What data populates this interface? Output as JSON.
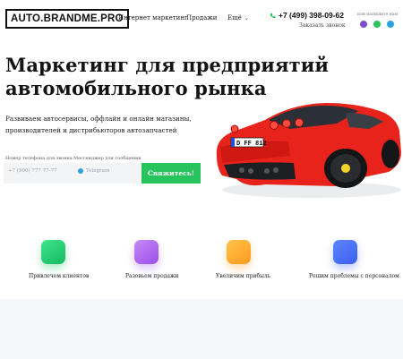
{
  "header": {
    "logo": "AUTO.BRANDME.PRO",
    "nav": [
      {
        "label": "Интернет маркетинг"
      },
      {
        "label": "Продажи"
      },
      {
        "label": "Ещё"
      }
    ],
    "phone": "+7 (499) 398-09-62",
    "callback": "Заказать звонок",
    "messengers_label": "или напишите нам",
    "messengers": [
      "viber-icon",
      "whatsapp-icon",
      "telegram-icon"
    ]
  },
  "hero": {
    "title": "Маркетинг для предприятий автомобильного рынка",
    "subtitle": "Развиваем автосервисы, оффлайн и онлайн магазины, производителей и дистрибьюторов автозапчастей",
    "car_plate": "D FF 812"
  },
  "form": {
    "phone_label": "Номер телефона для звонка",
    "phone_placeholder": "+7 (900) 777 77-77",
    "messenger_label": "Мессенджер для сообщения",
    "messenger_value": "Telegram",
    "submit": "Свяжитесь!"
  },
  "features": [
    {
      "label": "Привлечем клиентов",
      "icon": "users-icon",
      "color": "#27c35d"
    },
    {
      "label": "Разовьем продажи",
      "icon": "sales-icon",
      "color": "#a85ff0"
    },
    {
      "label": "Увеличим прибыль",
      "icon": "profit-icon",
      "color": "#ffab2e"
    },
    {
      "label": "Решим проблемы с персоналом",
      "icon": "staff-icon",
      "color": "#4a6ef5"
    }
  ],
  "colors": {
    "accent_green": "#27c35d",
    "car_red": "#e8231c"
  }
}
